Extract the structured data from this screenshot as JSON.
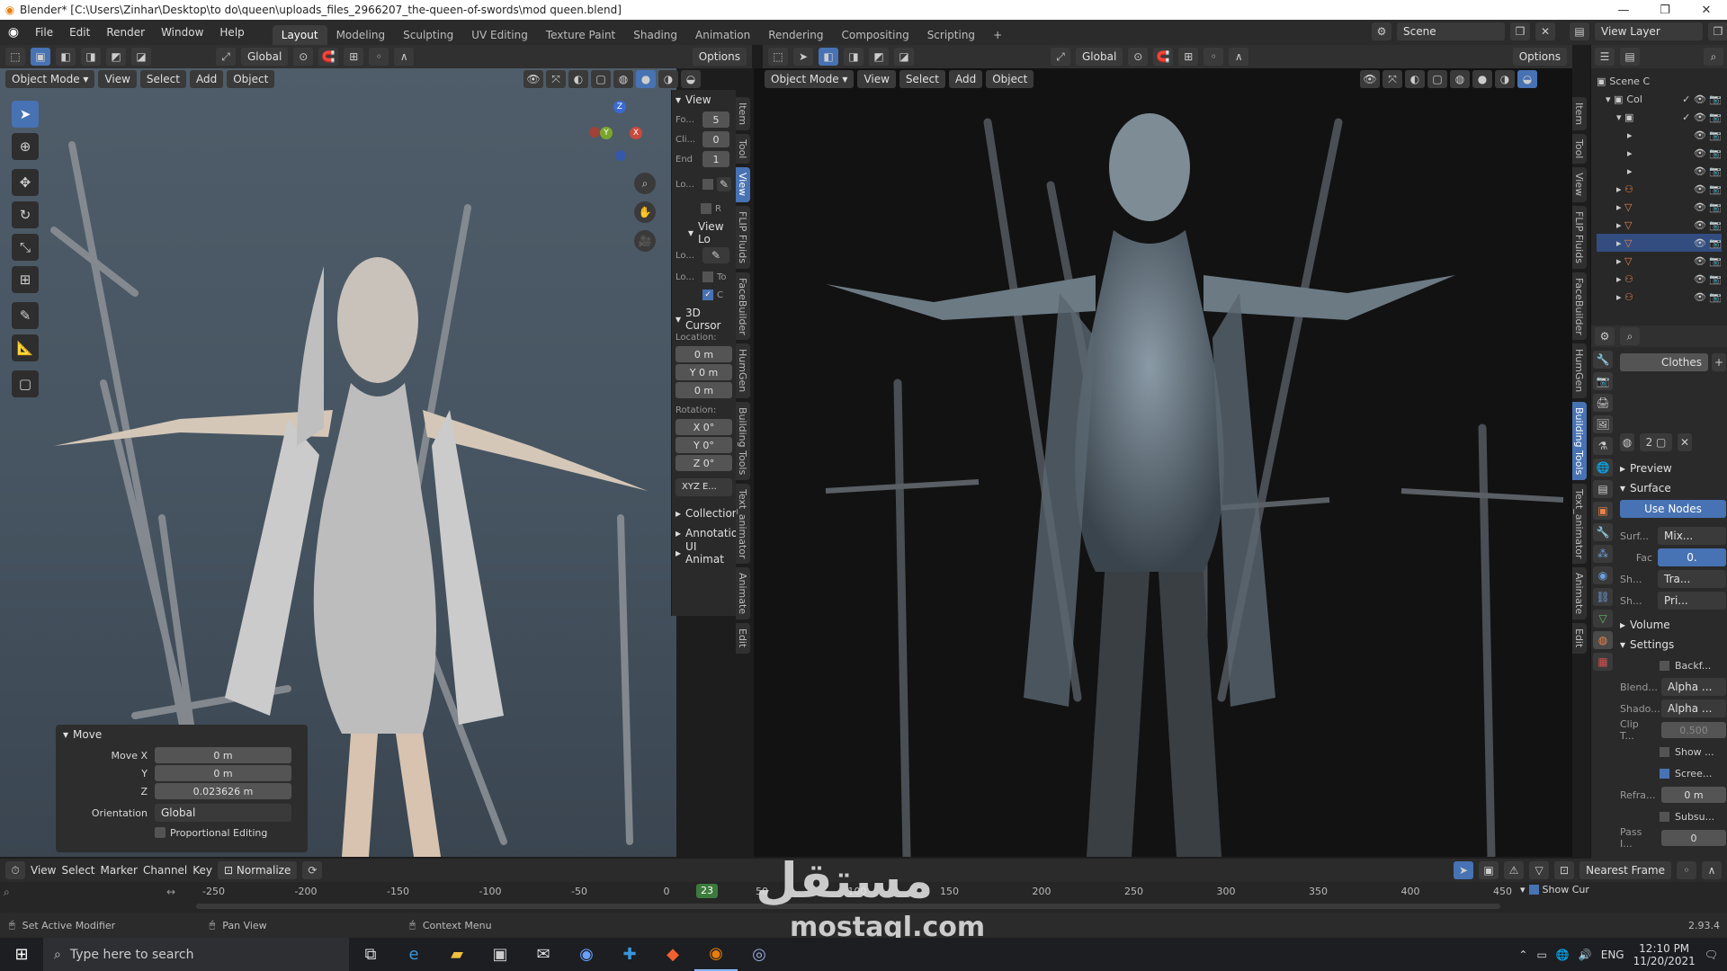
{
  "titlebar": {
    "text": "Blender* [C:\\Users\\Zinhar\\Desktop\\to do\\queen\\uploads_files_2966207_the-queen-of-swords\\mod queen.blend]",
    "minimize": "—",
    "maximize": "❐",
    "close": "✕"
  },
  "menubar": {
    "menus": [
      "File",
      "Edit",
      "Render",
      "Window",
      "Help"
    ],
    "workspaces": [
      "Layout",
      "Modeling",
      "Sculpting",
      "UV Editing",
      "Texture Paint",
      "Shading",
      "Animation",
      "Rendering",
      "Compositing",
      "Scripting"
    ],
    "add_tab": "+",
    "scene_label": "Scene",
    "view_layer_label": "View Layer"
  },
  "left_viewport": {
    "transform_orientation": "Global",
    "options_label": "Options",
    "mode": "Object Mode",
    "menu": [
      "View",
      "Select",
      "Add",
      "Object"
    ],
    "gizmo": {
      "z": "Z",
      "y": "Y",
      "x": "X"
    },
    "npanel": {
      "view_header": "View",
      "focal": "Fo...",
      "focal_val": "5",
      "clip_start": "Cli...",
      "clip_start_val": "0",
      "clip_end": "End",
      "clip_end_val": "1",
      "lock_label": "Lo...",
      "r_label": "R",
      "view_lock_header": "View Lo",
      "lock2_label": "Lo...",
      "lock3_label": "Lo...",
      "to_label": "To",
      "c_label": "C",
      "cursor_header": "3D Cursor",
      "location_label": "Location:",
      "loc_x": "0 m",
      "loc_y": "Y  0 m",
      "loc_z": "0 m",
      "rotation_label": "Rotation:",
      "rot_x": "X    0°",
      "rot_y": "Y    0°",
      "rot_z": "Z    0°",
      "rot_mode": "XYZ E...",
      "collection": "Collection",
      "annotations": "Annotatio",
      "ui_anim": "UI Animat"
    },
    "vtabs": [
      "Item",
      "Tool",
      "View",
      "FLIP Fluids",
      "FaceBuilder",
      "HumGen",
      "Building Tools",
      "Text_animator",
      "Animate",
      "Edit"
    ],
    "move_panel": {
      "title": "Move",
      "move_x_label": "Move X",
      "move_x": "0 m",
      "y_label": "Y",
      "y": "0 m",
      "z_label": "Z",
      "z": "0.023626 m",
      "orientation_label": "Orientation",
      "orientation": "Global",
      "prop_editing": "Proportional Editing"
    }
  },
  "right_viewport": {
    "transform_orientation": "Global",
    "options_label": "Options",
    "mode": "Object Mode",
    "menu": [
      "View",
      "Select",
      "Add",
      "Object"
    ],
    "vtabs": [
      "Item",
      "Tool",
      "View",
      "FLIP Fluids",
      "FaceBuilder",
      "HumGen",
      "Building Tools",
      "Text_animator",
      "Animate",
      "Edit"
    ]
  },
  "outliner": {
    "scene_collection": "Scene C",
    "col": "Col"
  },
  "properties": {
    "material_name": "Clothes",
    "preview": "Preview",
    "surface": "Surface",
    "use_nodes": "Use Nodes",
    "surf_label": "Surf...",
    "surf_val": "Mix...",
    "fac_label": "Fac",
    "fac_val": "0.",
    "sh1_label": "Sh...",
    "sh1_val": "Tra...",
    "sh2_label": "Sh...",
    "sh2_val": "Pri...",
    "volume": "Volume",
    "settings": "Settings",
    "backface": "Backf...",
    "blend_label": "Blend...",
    "blend_val": "Alpha ...",
    "shadow_label": "Shado...",
    "shadow_val": "Alpha ...",
    "clip_label": "Clip T...",
    "clip_val": "0.500",
    "show_label": "Show ...",
    "screen_label": "Scree...",
    "refr_label": "Refra...",
    "refr_val": "0 m",
    "subsu_label": "Subsu...",
    "pass_label": "Pass I...",
    "pass_val": "0"
  },
  "timeline": {
    "menu": [
      "View",
      "Select",
      "Marker",
      "Channel",
      "Key"
    ],
    "normalize": "Normalize",
    "snap": "Nearest Frame",
    "show_cursor": "Show Cur",
    "ticks": [
      "-250",
      "-200",
      "-150",
      "-100",
      "-50",
      "0",
      "50",
      "100",
      "150",
      "200",
      "250",
      "300",
      "350",
      "400",
      "450"
    ],
    "current_frame": "23"
  },
  "statusbar": {
    "a": "Set Active Modifier",
    "b": "Pan View",
    "c": "Context Menu",
    "version": "2.93.4"
  },
  "taskbar": {
    "search_placeholder": "Type here to search",
    "lang": "ENG",
    "time": "12:10 PM",
    "date": "11/20/2021"
  },
  "watermark": {
    "arabic": "مستقل",
    "latin": "mostaql.com"
  }
}
